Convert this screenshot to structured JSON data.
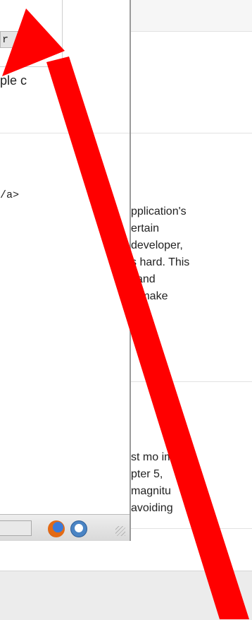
{
  "background": {
    "section1": [
      "pplication's",
      "ertain",
      " developer,",
      "s hard. This",
      "j and",
      "u make"
    ],
    "section2": [
      "st mo     ime",
      "pter 5,",
      "magnitu  ",
      "avoiding"
    ]
  },
  "popup": {
    "code_chip": "r",
    "text_line": "ple c",
    "mono_line": "/a>"
  },
  "statusbar": {
    "icons": [
      "firefox-icon",
      "toolbar-app-icon"
    ]
  },
  "annotation": {
    "arrow_color": "#ff0000"
  }
}
